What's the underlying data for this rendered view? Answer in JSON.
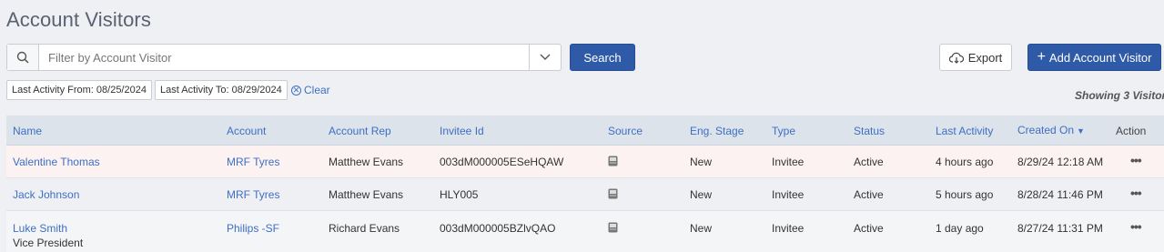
{
  "page": {
    "title": "Account Visitors"
  },
  "search": {
    "placeholder": "Filter by Account Visitor",
    "button_label": "Search"
  },
  "toolbar": {
    "export_label": "Export",
    "add_label": "Add Account Visitor"
  },
  "filters": {
    "from_label": "Last Activity From: 08/25/2024",
    "to_label": "Last Activity To: 08/29/2024",
    "clear_label": "Clear"
  },
  "summary": {
    "showing": "Showing 3 Visitors"
  },
  "table": {
    "headers": {
      "name": "Name",
      "account": "Account",
      "account_rep": "Account Rep",
      "invitee_id": "Invitee Id",
      "source": "Source",
      "eng_stage": "Eng. Stage",
      "type": "Type",
      "status": "Status",
      "last_activity": "Last Activity",
      "created_on": "Created On",
      "action": "Action"
    },
    "sort": {
      "column": "created_on",
      "direction": "descending"
    },
    "rows": [
      {
        "name": "Valentine Thomas",
        "subtitle": "",
        "account": "MRF Tyres",
        "account_rep": "Matthew Evans",
        "invitee_id": "003dM000005ESeHQAW",
        "source_icon": "device-icon",
        "eng_stage": "New",
        "type": "Invitee",
        "status": "Active",
        "last_activity": "4 hours ago",
        "created_on": "8/29/24 12:18 AM",
        "action": "•••"
      },
      {
        "name": "Jack Johnson",
        "subtitle": "",
        "account": "MRF Tyres",
        "account_rep": "Matthew Evans",
        "invitee_id": "HLY005",
        "source_icon": "device-icon",
        "eng_stage": "New",
        "type": "Invitee",
        "status": "Active",
        "last_activity": "5 hours ago",
        "created_on": "8/28/24 11:46 PM",
        "action": "•••"
      },
      {
        "name": "Luke Smith",
        "subtitle": "Vice President",
        "account": "Philips -SF",
        "account_rep": "Richard Evans",
        "invitee_id": "003dM000005BZlvQAO",
        "source_icon": "device-icon",
        "eng_stage": "New",
        "type": "Invitee",
        "status": "Active",
        "last_activity": "1 day ago",
        "created_on": "8/27/24 11:31 PM",
        "action": "•••"
      }
    ]
  },
  "colors": {
    "primary": "#2f5aa8",
    "link": "#3d6fc4",
    "header_bg": "#dde3ea",
    "highlight_row": "#fdf2f2"
  }
}
